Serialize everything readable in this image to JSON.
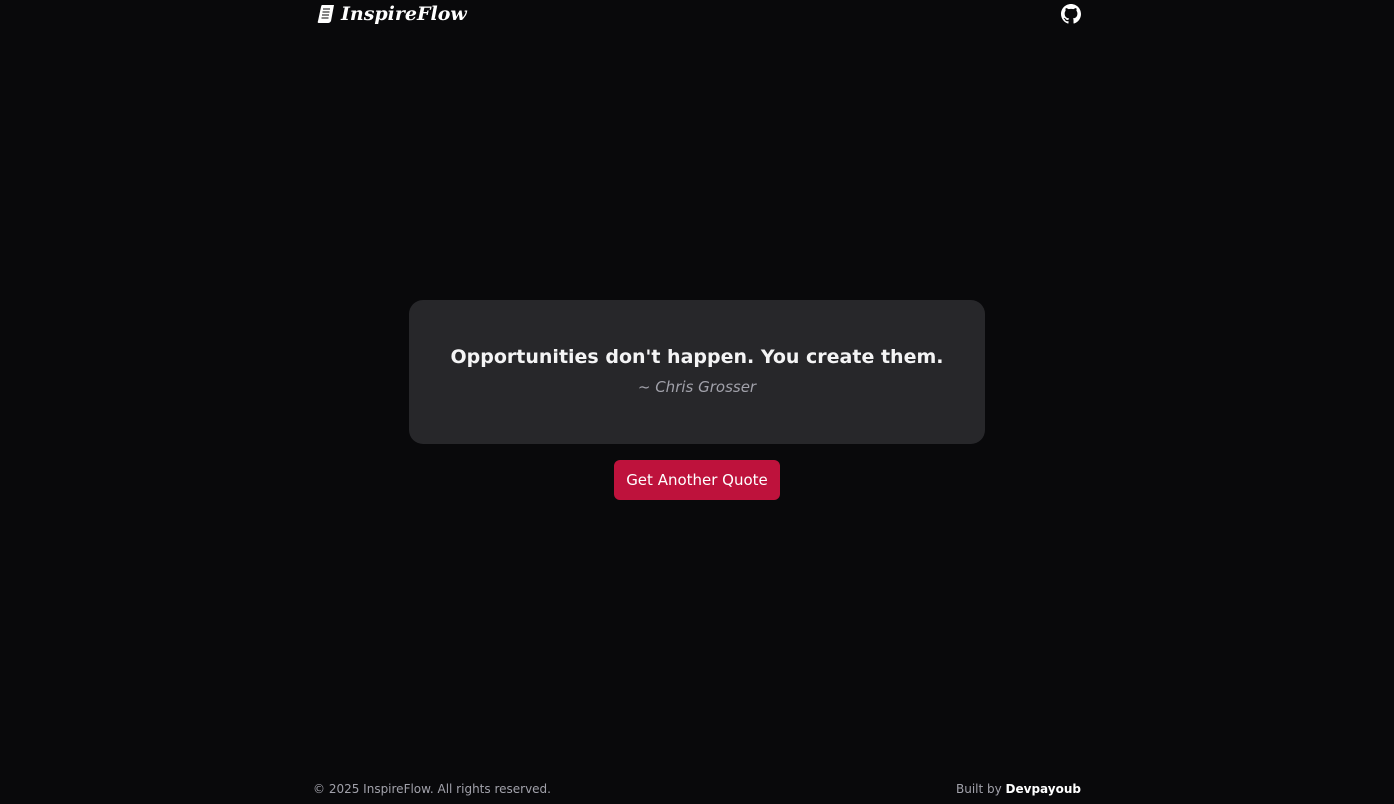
{
  "header": {
    "brand_icon": "scroll-icon",
    "brand_name": "InspireFlow",
    "github_icon": "github-icon"
  },
  "quote": {
    "text": "Opportunities don't happen. You create them.",
    "author": "~ Chris Grosser"
  },
  "actions": {
    "new_quote_label": "Get Another Quote"
  },
  "footer": {
    "copyright": "© 2025 InspireFlow. All rights reserved.",
    "built_by_prefix": "Built by",
    "built_by_name": "Devpayoub"
  },
  "colors": {
    "background": "#09090b",
    "card": "#27272a",
    "accent": "#be123c",
    "text_primary": "#f4f4f5",
    "text_muted": "#a1a1aa"
  }
}
